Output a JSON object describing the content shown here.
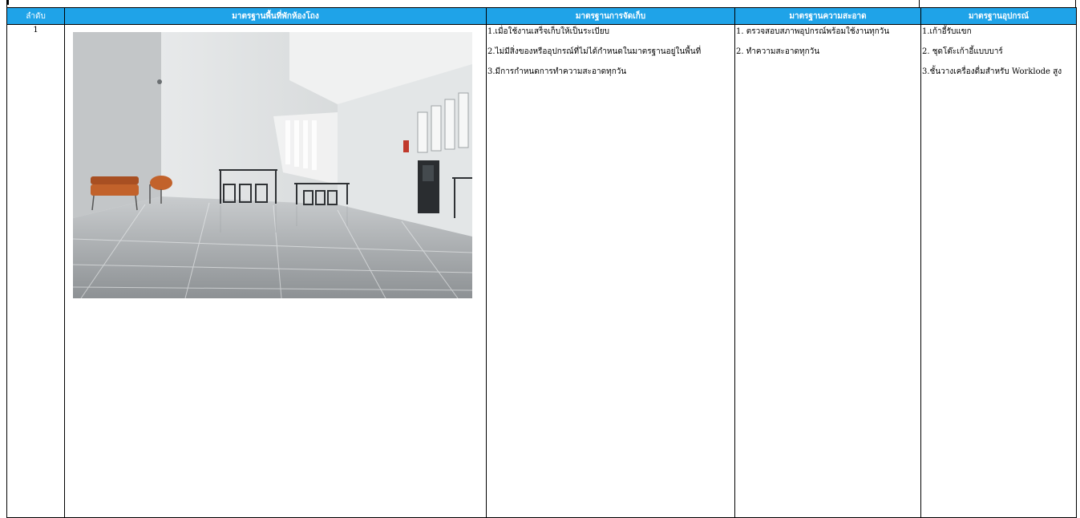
{
  "table": {
    "headers": {
      "seq": "ลำดับ",
      "area": "มาตรฐานพื้นที่พักห้องโถง",
      "storage": "มาตรฐานการจัดเก็บ",
      "cleaning": "มาตรฐานความสะอาด",
      "equipment": "มาตรฐานอุปกรณ์"
    },
    "rows": [
      {
        "seq": "1",
        "storage": [
          "1.เมื่อใช้งานเสร็จเก็บให้เป็นระเบียบ",
          "2.ไม่มีสิ่งของหรืออุปกรณ์ที่ไม่ได้กำหนดในมาตรฐานอยู่ในพื้นที่",
          "3.มีการกำหนดการทำความสะอาดทุกวัน"
        ],
        "cleaning": [
          "1. ตรวจสอบสภาพอุปกรณ์พร้อมใช้งานทุกวัน",
          "2. ทำความสะอาดทุกวัน"
        ],
        "equipment": [
          "1.เก้าอี้รับแขก",
          "2. ชุดโต๊ะเก้าอี้แบบบาร์",
          "3.ชั้นวางเครื่องดื่มสำหรับ Worklode สูง"
        ]
      }
    ]
  },
  "colors": {
    "header_bg": "#1fa3e8",
    "header_text": "#ffffff"
  }
}
